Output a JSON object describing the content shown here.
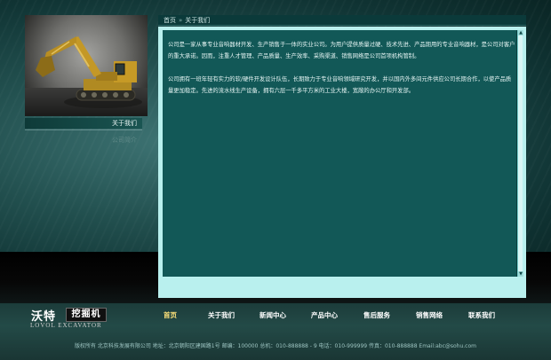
{
  "sidebar": {
    "title": "关于我们",
    "links": [
      "公司简介"
    ]
  },
  "breadcrumb": {
    "home": "首页",
    "separator": "»",
    "current": "关于我们"
  },
  "content": {
    "paragraphs": [
      "公司是一家从事专业音响器材开发、生产销售于一体的实业公司。为用户提供质量过硬、技术先进、产品期用的专业音响器材，是公司对客户的重大承诺。因而，注重人才管理、产品质量、生产效率、采购渠道、销售网络是公司首项机构管制。",
      "公司拥有一班年轻有实力的软/硬件开发设计队伍，长期致力于专业音响领域研究开发，并以国内外多间元件供应公司长期合作，以使产品质量更加稳定。先进的流水线生产设备，拥有六层一千多平方米的工业大楼，宽敞的办公厅和开发部。"
    ]
  },
  "logo": {
    "cn_name": "沃特",
    "cn_tag": "挖掘机",
    "en_name": "LOVOL EXCAVATOR"
  },
  "nav": {
    "items": [
      "首页",
      "关于我们",
      "新闻中心",
      "产品中心",
      "售后服务",
      "销售网络",
      "联系我们"
    ],
    "active_index": 0
  },
  "footer": {
    "info": "版权所有  北京科技发展有限公司 地址：北京朝阳区建国路1号 邮编：100000   总机：010-888888 - 9 电话：010-999999 传真：010-888888 Email:abc@sohu.com"
  },
  "colors": {
    "accent_active": "#ffe27a",
    "panel_bg": "#125857",
    "panel_frame": "#b9f0ee"
  }
}
